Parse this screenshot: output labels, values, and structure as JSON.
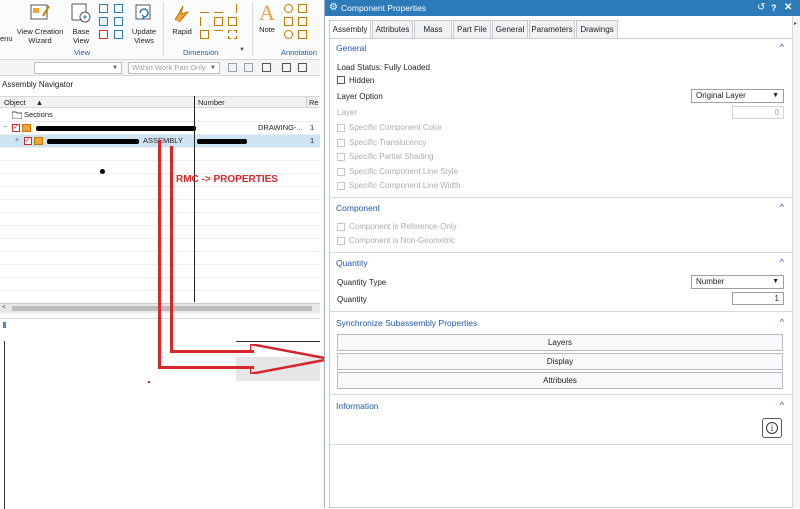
{
  "ribbon": {
    "buttons": [
      {
        "label": "View Creation Wizard"
      },
      {
        "label": "Base View"
      },
      {
        "label": "Update Views"
      },
      {
        "label": "Rapid"
      },
      {
        "label": "Note"
      }
    ],
    "groups": [
      "View",
      "Dimension",
      "Annotation"
    ],
    "menu_fragment": "enu"
  },
  "filterbar": {
    "scope": "Within Work Part Only"
  },
  "navigator": {
    "title": "Assembly Navigator",
    "columns": [
      "Object",
      "Number",
      "Re"
    ],
    "rows": [
      {
        "object": "Sections",
        "number": "",
        "rev": ""
      },
      {
        "object": "",
        "number": "DRAWING-...",
        "rev": "1"
      },
      {
        "object": "ASSEMBLY",
        "number": "",
        "rev": "1"
      }
    ]
  },
  "annotation": {
    "text": "RMC -> PROPERTIES"
  },
  "dialog": {
    "title": "Component Properties",
    "tabs": [
      "Assembly",
      "Attributes",
      "Mass",
      "Part File",
      "General",
      "Parameters",
      "Drawings"
    ],
    "general": {
      "heading": "General",
      "load_status": "Load Status: Fully Loaded",
      "hidden_label": "Hidden",
      "layer_option_label": "Layer Option",
      "layer_option_value": "Original Layer",
      "layer_label": "Layer",
      "layer_value": "0",
      "options": [
        "Specific Component Color",
        "Specific Translucency",
        "Specific Partial Shading",
        "Specific Component Line Style",
        "Specific Component Line Width"
      ]
    },
    "component": {
      "heading": "Component",
      "options": [
        "Component is Reference-Only",
        "Component is Non-Geometric"
      ]
    },
    "quantity": {
      "heading": "Quantity",
      "type_label": "Quantity Type",
      "type_value": "Number",
      "quantity_label": "Quantity",
      "quantity_value": "1"
    },
    "sync": {
      "heading": "Synchronize Subassembly Properties",
      "buttons": [
        "Layers",
        "Display",
        "Attributes"
      ]
    },
    "information": {
      "heading": "Information"
    }
  },
  "colors": {
    "accent": "#2d7ab8",
    "annotation": "#d7272b",
    "heading": "#1f5aa6"
  }
}
